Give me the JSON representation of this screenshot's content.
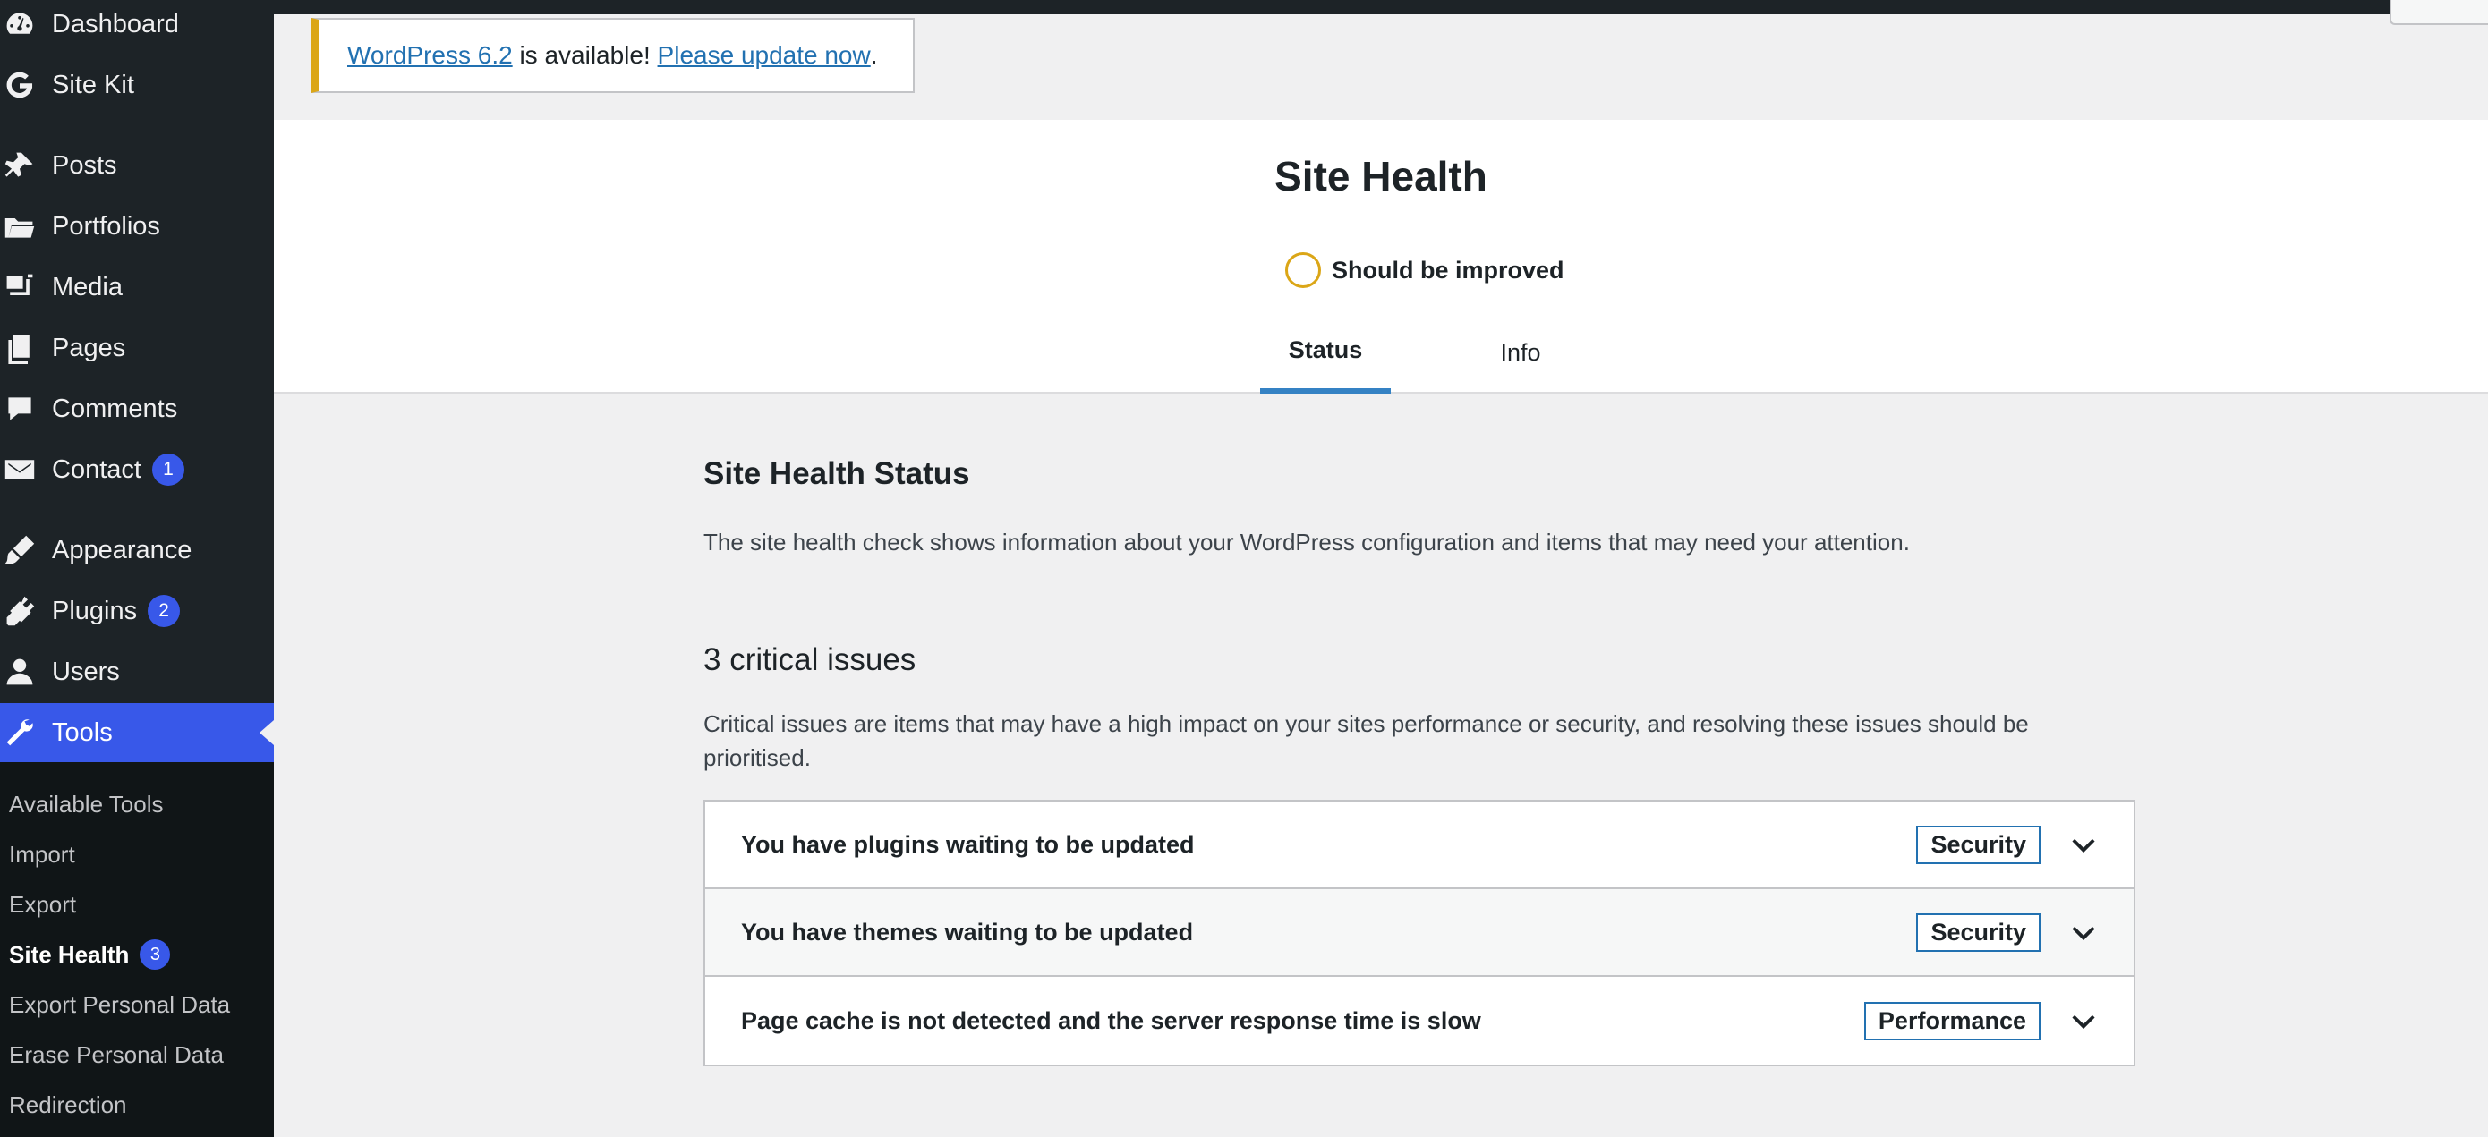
{
  "sidebar": {
    "items": [
      {
        "label": "Dashboard",
        "icon": "dashboard-icon"
      },
      {
        "label": "Site Kit",
        "icon": "google-g-icon"
      },
      {
        "label": "Posts",
        "icon": "pin-icon"
      },
      {
        "label": "Portfolios",
        "icon": "folder-icon"
      },
      {
        "label": "Media",
        "icon": "media-icon"
      },
      {
        "label": "Pages",
        "icon": "pages-icon"
      },
      {
        "label": "Comments",
        "icon": "comment-icon"
      },
      {
        "label": "Contact",
        "icon": "mail-icon",
        "badge": "1"
      },
      {
        "label": "Appearance",
        "icon": "brush-icon"
      },
      {
        "label": "Plugins",
        "icon": "plugin-icon",
        "badge": "2"
      },
      {
        "label": "Users",
        "icon": "user-icon"
      },
      {
        "label": "Tools",
        "icon": "wrench-icon",
        "active": true
      }
    ],
    "submenu": [
      {
        "label": "Available Tools"
      },
      {
        "label": "Import"
      },
      {
        "label": "Export"
      },
      {
        "label": "Site Health",
        "badge": "3",
        "current": true
      },
      {
        "label": "Export Personal Data"
      },
      {
        "label": "Erase Personal Data"
      },
      {
        "label": "Redirection"
      }
    ]
  },
  "notice": {
    "version_link": "WordPress 6.2",
    "middle_text": " is available! ",
    "update_link": "Please update now",
    "end_text": "."
  },
  "header": {
    "title": "Site Health",
    "rating": "Should be improved",
    "tabs": [
      {
        "label": "Status",
        "active": true
      },
      {
        "label": "Info",
        "active": false
      }
    ]
  },
  "main": {
    "status_heading": "Site Health Status",
    "status_description": "The site health check shows information about your WordPress configuration and items that may need your attention.",
    "critical_heading": "3 critical issues",
    "critical_description": "Critical issues are items that may have a high impact on your sites performance or security, and resolving these issues should be prioritised.",
    "issues": [
      {
        "title": "You have plugins waiting to be updated",
        "tag": "Security"
      },
      {
        "title": "You have themes waiting to be updated",
        "tag": "Security"
      },
      {
        "title": "Page cache is not detected and the server response time is slow",
        "tag": "Performance"
      }
    ]
  },
  "colors": {
    "sidebar_bg": "#1d2327",
    "accent": "#3858e9",
    "notice_warning": "#dba617",
    "link": "#2271b1"
  }
}
